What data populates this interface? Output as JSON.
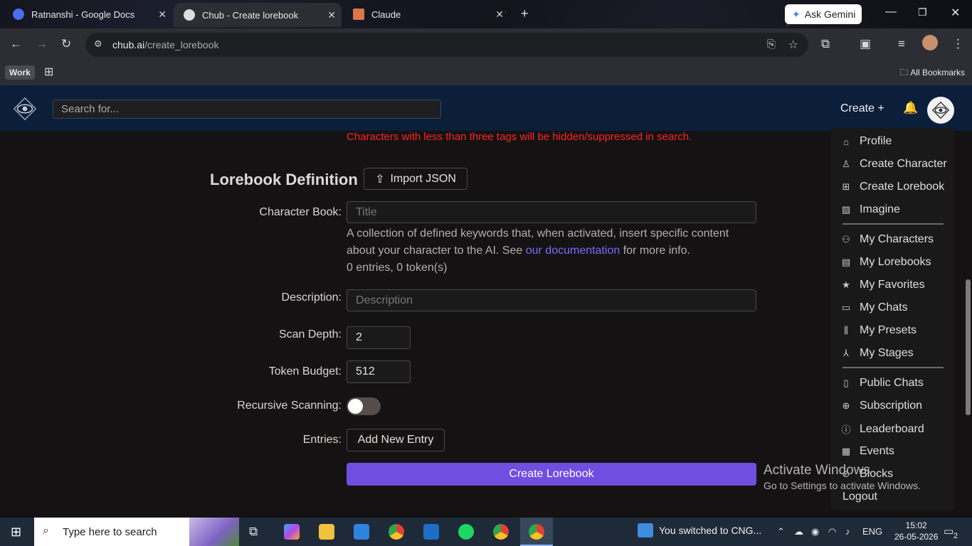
{
  "browser": {
    "tabs": [
      {
        "label": "Ratnanshi - Google Docs",
        "close": "✕"
      },
      {
        "label": "Chub - Create lorebook",
        "close": "✕"
      },
      {
        "label": "Claude",
        "close": "✕"
      }
    ],
    "new_tab": "+",
    "ask_gemini": "Ask Gemini",
    "url_host": "chub.ai",
    "url_path": "/create_lorebook",
    "bookmark_group": "Work",
    "all_bookmarks": "All Bookmarks"
  },
  "site": {
    "search_placeholder": "Search for...",
    "create_label": "Create +"
  },
  "form": {
    "warning": "Characters with less than three tags will be hidden/suppressed in search.",
    "title": "Lorebook Definition",
    "import_label": "Import JSON",
    "character_book_label": "Character Book:",
    "title_placeholder": "Title",
    "help_before": "A collection of defined keywords that, when activated, insert specific content about your character to the AI. See ",
    "help_link": "our documentation",
    "help_after": " for more info.",
    "stats": "0 entries, 0 token(s)",
    "description_label": "Description:",
    "description_placeholder": "Description",
    "scan_depth_label": "Scan Depth:",
    "scan_depth_value": "2",
    "token_budget_label": "Token Budget:",
    "token_budget_value": "512",
    "recursive_label": "Recursive Scanning:",
    "recursive_on": false,
    "entries_label": "Entries:",
    "add_entry_label": "Add New Entry",
    "submit_label": "Create Lorebook"
  },
  "menu": {
    "group1": [
      {
        "label": "Profile",
        "icon": "home-icon"
      },
      {
        "label": "Create Character",
        "icon": "user-icon"
      },
      {
        "label": "Create Lorebook",
        "icon": "plus-box-icon"
      },
      {
        "label": "Imagine",
        "icon": "image-icon"
      }
    ],
    "group2": [
      {
        "label": "My Characters",
        "icon": "users-icon"
      },
      {
        "label": "My Lorebooks",
        "icon": "book-icon"
      },
      {
        "label": "My Favorites",
        "icon": "star-icon"
      },
      {
        "label": "My Chats",
        "icon": "chat-icon"
      },
      {
        "label": "My Presets",
        "icon": "sliders-icon"
      },
      {
        "label": "My Stages",
        "icon": "stage-icon"
      }
    ],
    "group3": [
      {
        "label": "Public Chats",
        "icon": "bookmark-icon"
      },
      {
        "label": "Subscription",
        "icon": "plus-circle-icon"
      },
      {
        "label": "Leaderboard",
        "icon": "info-icon"
      },
      {
        "label": "Events",
        "icon": "calendar-icon"
      },
      {
        "label": "Blocks",
        "icon": "block-icon"
      }
    ],
    "logout": "Logout"
  },
  "overlay": {
    "activate_title": "Activate Windows",
    "activate_sub": "Go to Settings to activate Windows."
  },
  "taskbar": {
    "search_placeholder": "Type here to search",
    "notification": "You switched to CNG...",
    "lang": "ENG",
    "time": "15:02",
    "date": "26-05-2026",
    "badge": "2"
  },
  "colors": {
    "accent": "#6f4ee0",
    "warning": "#ff2424",
    "header": "#0b1e3a",
    "link": "#7e6bff"
  }
}
